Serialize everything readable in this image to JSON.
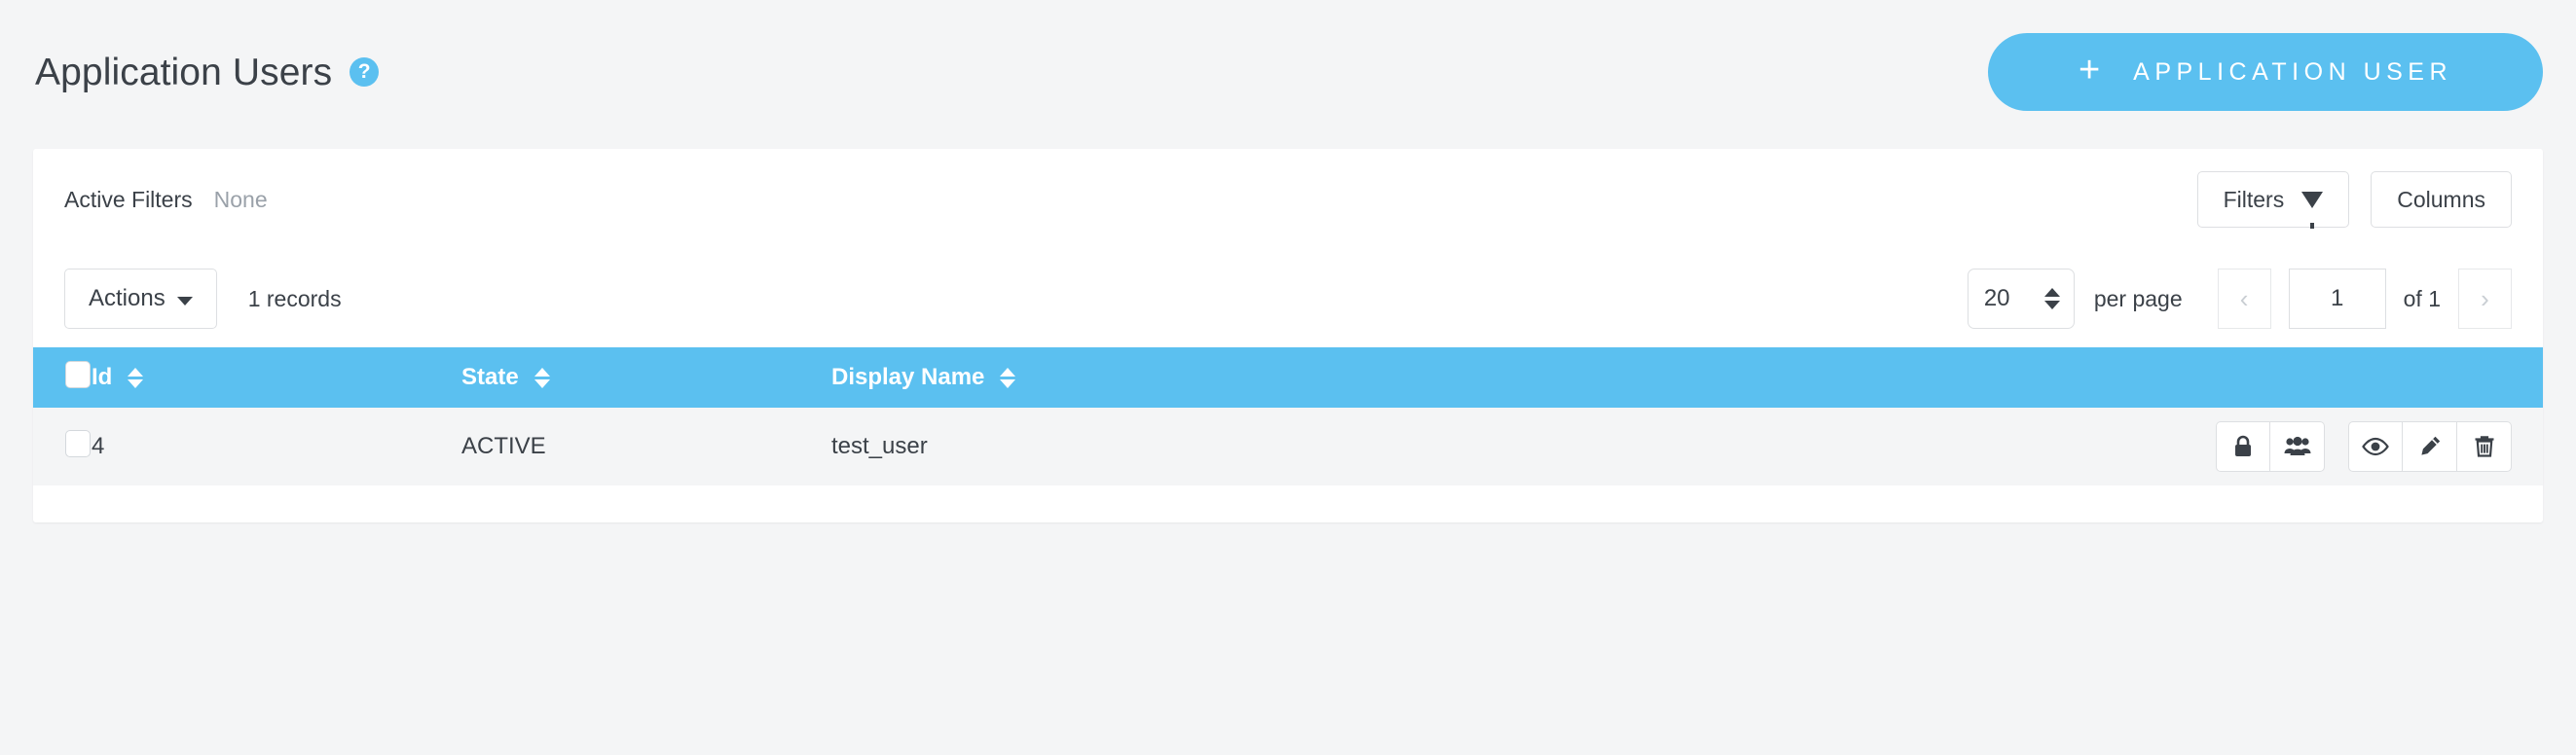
{
  "header": {
    "title": "Application Users",
    "help_icon": "question-circle-icon",
    "primary_button": {
      "plus": "+",
      "label": "APPLICATION USER"
    }
  },
  "filter_bar": {
    "active_filters_label": "Active Filters",
    "active_filters_value": "None",
    "filters_button": "Filters",
    "filters_icon": "funnel-icon",
    "columns_button": "Columns"
  },
  "toolbar": {
    "actions_label": "Actions",
    "actions_caret": "caret-down-icon",
    "records_text": "1 records",
    "per_page_value": "20",
    "per_page_label": "per page",
    "prev_symbol": "‹",
    "next_symbol": "›",
    "page_value": "1",
    "of_text": "of 1"
  },
  "table": {
    "columns": [
      {
        "key": "checkbox",
        "label": "",
        "sortable": false
      },
      {
        "key": "id",
        "label": "Id",
        "sortable": true
      },
      {
        "key": "state",
        "label": "State",
        "sortable": true
      },
      {
        "key": "display_name",
        "label": "Display Name",
        "sortable": true
      },
      {
        "key": "actions",
        "label": "",
        "sortable": false
      }
    ],
    "rows": [
      {
        "id": "4",
        "state": "ACTIVE",
        "display_name": "test_user",
        "actions": [
          "lock-icon",
          "users-group-icon",
          "eye-icon",
          "pencil-icon",
          "trash-icon"
        ]
      }
    ]
  },
  "colors": {
    "accent_blue": "#5bc0f0",
    "page_background": "#f4f5f6",
    "card_background": "#ffffff",
    "text_primary": "#3b4148",
    "text_muted": "#9aa1a9",
    "border": "#dddfe2"
  }
}
